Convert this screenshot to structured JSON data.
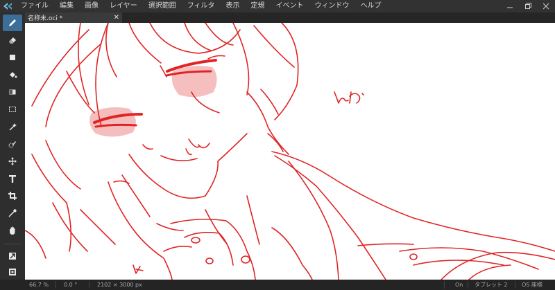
{
  "menu": {
    "items": [
      "ファイル",
      "編集",
      "画像",
      "レイヤー",
      "選択範囲",
      "フィルタ",
      "表示",
      "定規",
      "イベント",
      "ウィンドウ",
      "ヘルプ"
    ]
  },
  "window": {
    "controls": [
      "minimize-icon",
      "restore-icon",
      "close-icon"
    ]
  },
  "tab": {
    "title": "名称未.oci *",
    "close": "✕"
  },
  "toolbar": {
    "tools": [
      "pen-icon",
      "eraser-icon",
      "rectangle-icon",
      "fill-bucket-icon",
      "gradient-icon",
      "rect-select-icon",
      "magic-wand-icon",
      "select-pen-icon",
      "move-icon",
      "text-tool-icon",
      "crop-icon",
      "eyedropper-icon",
      "hand-icon",
      "color-swap-icon",
      "color-palette-icon"
    ],
    "active": "pen-icon"
  },
  "canvas": {
    "handwritten_text": "んぺ"
  },
  "status": {
    "zoom": "66.7 %",
    "rotation": "0.0 °",
    "size": "2102 × 3000 px",
    "pressure": "On",
    "tablet": "タブレット 2",
    "coords": "OS 座標"
  },
  "colors": {
    "accent": "#3c6e9a",
    "line_art": "#e02424",
    "blush": "#f2b3b3"
  }
}
